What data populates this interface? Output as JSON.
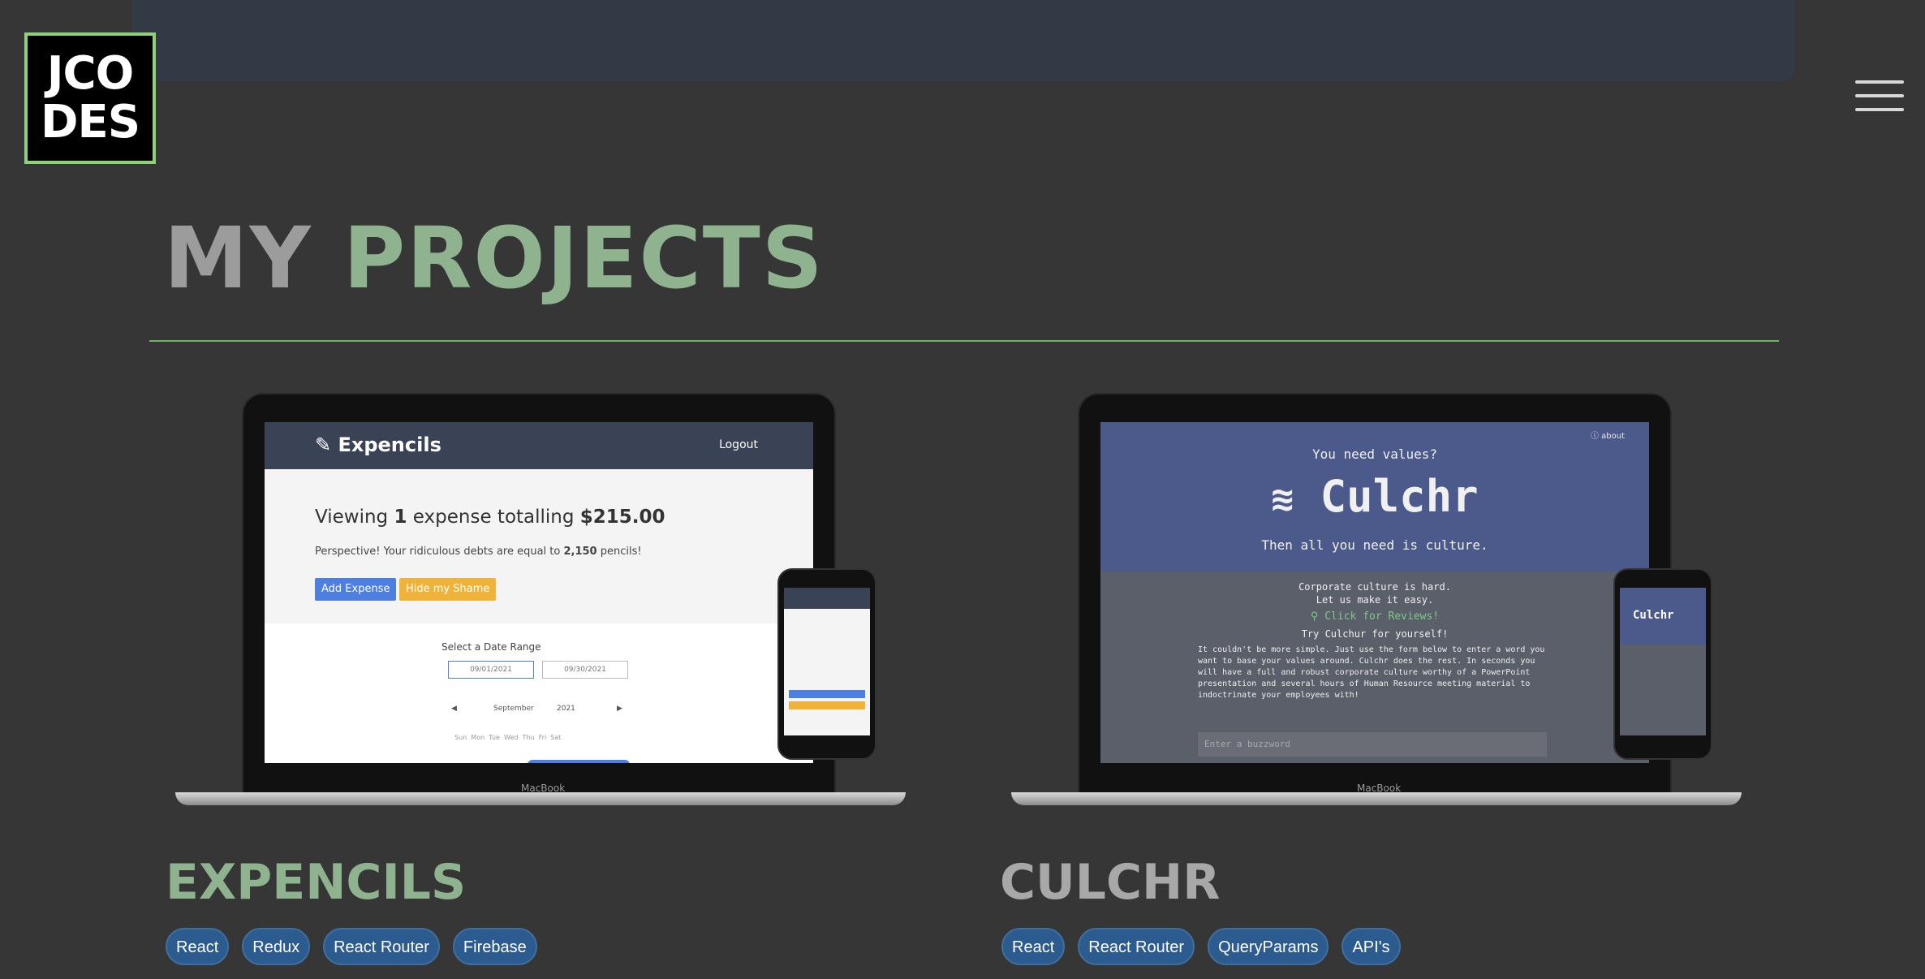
{
  "header": {
    "logo_line1": "JCO",
    "logo_line2": "DES",
    "menu_icon": "hamburger-menu-icon"
  },
  "page": {
    "title_part1": "MY ",
    "title_part2": "PROJECTS"
  },
  "projects": [
    {
      "title": "EXPENCILS",
      "tags": [
        "React",
        "Redux",
        "React Router",
        "Firebase"
      ],
      "mockup": {
        "brand": "Expencils",
        "logout": "Logout",
        "viewing_prefix": "Viewing ",
        "viewing_count": "1",
        "viewing_mid": " expense totalling ",
        "viewing_total": "$215.00",
        "perspective_prefix": "Perspective! Your ridiculous debts are equal to ",
        "perspective_count": "2,150",
        "perspective_suffix": " pencils!",
        "add_button": "Add Expense",
        "hide_button": "Hide my Shame",
        "date_range_label": "Select a Date Range",
        "start_date": "09/01/2021",
        "end_date": "09/30/2021",
        "month": "September",
        "year": "2021",
        "weekdays": "Sun  Mon  Tue  Wed  Thu  Fri  Sat",
        "laptop_label": "MacBook"
      }
    },
    {
      "title": "CULCHR",
      "tags": [
        "React",
        "React Router",
        "QueryParams",
        "API's"
      ],
      "mockup": {
        "about": "about",
        "tagline_top": "You need values?",
        "brand": "Culchr",
        "tagline_bottom": "Then all you need is culture.",
        "intro_line1": "Corporate culture is hard.",
        "intro_line2": "Let us make it easy.",
        "reviews_link": "Click for Reviews!",
        "try_line": "Try Culchur for yourself!",
        "description": "It couldn't be more simple. Just use the form below to enter a word you want to base your values around. Culchr does the rest. In seconds you will have a full and robust corporate culture worthy of a PowerPoint presentation and several hours of Human Resource meeting material to indoctrinate your employees with!",
        "input_placeholder": "Enter a buzzword",
        "laptop_label": "MacBook"
      }
    }
  ]
}
